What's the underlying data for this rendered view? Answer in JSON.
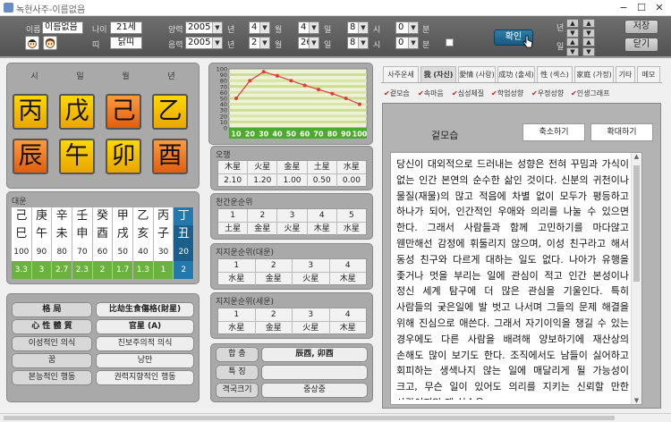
{
  "window": {
    "title": "녹현사주-이름없음",
    "minimize": "−",
    "maximize": "☐",
    "close": "✕"
  },
  "top": {
    "name_label": "이름",
    "name_value": "이름없음",
    "age_label": "나이",
    "age_value": "21세",
    "zodiac_label": "띠",
    "zodiac_value": "닭띠",
    "solar_label": "양력",
    "lunar_label": "음력",
    "solar": {
      "year": "2005",
      "month": "4",
      "day": "4",
      "hour": "8",
      "minute": "0"
    },
    "lunar": {
      "year": "2005",
      "month": "2",
      "day": "26",
      "hour": "8",
      "minute": "0"
    },
    "unit_year": "년",
    "unit_month": "월",
    "unit_day": "일",
    "unit_hour": "시",
    "unit_minute": "분",
    "confirm": "확인",
    "year_nav": "년",
    "day_nav": "일",
    "save": "저장",
    "close": "닫기"
  },
  "saju": {
    "headers": [
      "시",
      "일",
      "월",
      "년"
    ],
    "stems": [
      "丙",
      "戊",
      "己",
      "乙"
    ],
    "branches": [
      "辰",
      "午",
      "卯",
      "酉"
    ]
  },
  "daeun": {
    "title": "대운",
    "stems": [
      "己",
      "庚",
      "辛",
      "壬",
      "癸",
      "甲",
      "乙",
      "丙",
      "丁"
    ],
    "branches": [
      "巳",
      "午",
      "未",
      "申",
      "酉",
      "戌",
      "亥",
      "子",
      "丑"
    ],
    "ages": [
      "100",
      "90",
      "80",
      "70",
      "60",
      "50",
      "40",
      "30",
      "20"
    ],
    "scores": [
      "3.3",
      "3",
      "2.7",
      "2.3",
      "2",
      "1.7",
      "1.3",
      "1",
      "2"
    ],
    "current_index": 8
  },
  "summary": {
    "rows": [
      {
        "label": "格 局",
        "value": "比劫生食傷格(財星)"
      },
      {
        "label": "心 性 體 質",
        "value": "官星 (A)"
      },
      {
        "label": "이성적인 의식",
        "value": "진보주의적 의식"
      },
      {
        "label": "꿈",
        "value": "낭만"
      },
      {
        "label": "본능적인 행동",
        "value": "권력지향적인 행동"
      }
    ]
  },
  "chart_data": {
    "type": "line",
    "categories": [
      "10",
      "20",
      "30",
      "40",
      "50",
      "60",
      "70",
      "80",
      "90",
      "100"
    ],
    "values": [
      50,
      80,
      95,
      88,
      80,
      72,
      65,
      58,
      50,
      40
    ],
    "ylim": [
      0,
      100
    ],
    "yticks": [
      "100",
      "90",
      "80",
      "70",
      "60",
      "50",
      "40",
      "30",
      "20",
      "10",
      "0"
    ]
  },
  "ohaeng": {
    "title": "오행",
    "labels": [
      "木星",
      "火星",
      "金星",
      "土星",
      "水星"
    ],
    "values": [
      "2.10",
      "1.20",
      "1.00",
      "0.50",
      "0.00"
    ]
  },
  "cheongan": {
    "title": "천간운순위",
    "ranks": [
      "1",
      "2",
      "3",
      "4",
      "5"
    ],
    "values": [
      "土星",
      "金星",
      "火星",
      "木星",
      "水星"
    ]
  },
  "jiji_daeun": {
    "title": "지지운순위(대운)",
    "ranks": [
      "1",
      "2",
      "3",
      "4"
    ],
    "values": [
      "水星",
      "金星",
      "火星",
      "木星"
    ]
  },
  "jiji_seun": {
    "title": "지지운순위(세운)",
    "ranks": [
      "1",
      "2",
      "3",
      "4"
    ],
    "values": [
      "水星",
      "金星",
      "火星",
      "木星"
    ]
  },
  "hapchung": {
    "rows": [
      {
        "label": "합 충",
        "value": "辰酉, 卯酉"
      },
      {
        "label": "특 징",
        "value": ""
      },
      {
        "label": "격국크기",
        "value": "중상중"
      }
    ]
  },
  "tabs": [
    "사주운세",
    "我 (자신)",
    "愛情 (사랑)",
    "成功 (출세)",
    "性 (섹스)",
    "家庭 (가정)",
    "기타",
    "메모"
  ],
  "active_tab": 1,
  "subtabs": [
    "겉모습",
    "속마음",
    "심성체질",
    "학업성향",
    "우정성향",
    "인생그래프"
  ],
  "content": {
    "heading": "겉모습",
    "shrink": "축소하기",
    "enlarge": "확대하기",
    "body": "당신이 대외적으로 드러내는 성향은 전혀 꾸밈과 가식이 없는 인간 본연의 순수한 삶인 것이다. 신분의 귀천이나 물질(재물)의 많고 적음에 차별 없이 모두가 평등하고 하나가 되어, 인간적인 우애와 의리를 나눌 수 있으면 한다. 그래서 사람들과 함께 고민하기를 마다않고 웬만해선 감정에 휘둘리지 않으며, 이성 친구라고 해서 동성 친구와 다르게 대하는 일도 없다. 나아가 유행을 좇거나 멋을 부리는 일에 관심이 적고 인간 본성이나 정신 세계 탐구에 더 많은 관심을 기울인다. 특히 사람들의 궂은일에 발 벗고 나서며 그들의 문제 해결을 위해 진심으로 애쓴다. 그래서 자기이익을 챙길 수 있는 경우에도 다른 사람을 배려해 양보하기에 재산상의 손해도 많이 보기도 한다. 조직에서도 남들이 싫어하고 회피하는 생색나지 않는 일에 매달리게 될 가능성이 크고, 무슨 일이 있어도 의리를 지키는 신뢰할 만한 사람이지만 제 실속은"
  }
}
